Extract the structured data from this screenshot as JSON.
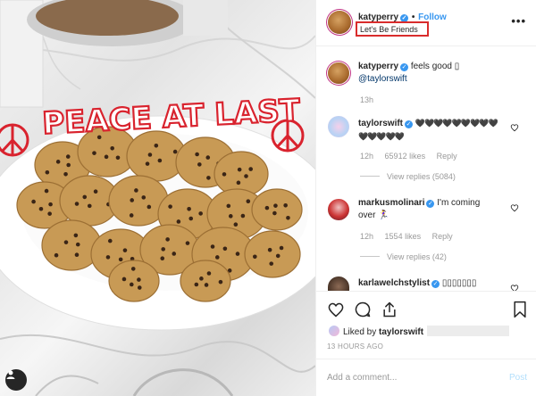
{
  "photo": {
    "plate_text": "PEACE AT LAST",
    "colors": {
      "icing": "#d9232e",
      "plate": "#ffffff",
      "cookie": "#c89a55",
      "chip": "#3a2516"
    }
  },
  "header": {
    "username": "katyperry",
    "verified_glyph": "✓",
    "separator": "•",
    "follow_label": "Follow",
    "caption": "Let's Be Friends",
    "more_label": "•••"
  },
  "comments": [
    {
      "username": "katyperry",
      "text": "feels good ▯",
      "mention": "@taylorswift",
      "time": "13h"
    },
    {
      "username": "taylorswift",
      "text": "🖤🖤🖤🖤🖤🖤🖤🖤🖤🖤🖤🖤🖤🖤",
      "time": "12h",
      "likes": "65912 likes",
      "reply": "Reply",
      "view_replies": "View replies (5084)"
    },
    {
      "username": "markusmolinari",
      "text": "I'm coming",
      "text2": "over 🏃‍♀️",
      "time": "12h",
      "likes": "1554 likes",
      "reply": "Reply",
      "view_replies": "View replies (42)"
    },
    {
      "username": "karlawelchstylist",
      "text": "▯▯▯▯▯▯▯"
    }
  ],
  "liked_by": {
    "prefix": "Liked by ",
    "user": "taylorswift"
  },
  "time_ago": "13 HOURS AGO",
  "add_comment": {
    "placeholder": "Add a comment...",
    "post_label": "Post"
  },
  "icons": [
    "heart-icon",
    "comment-icon",
    "share-icon",
    "bookmark-icon",
    "more-icon"
  ],
  "accent": "#3897f0"
}
